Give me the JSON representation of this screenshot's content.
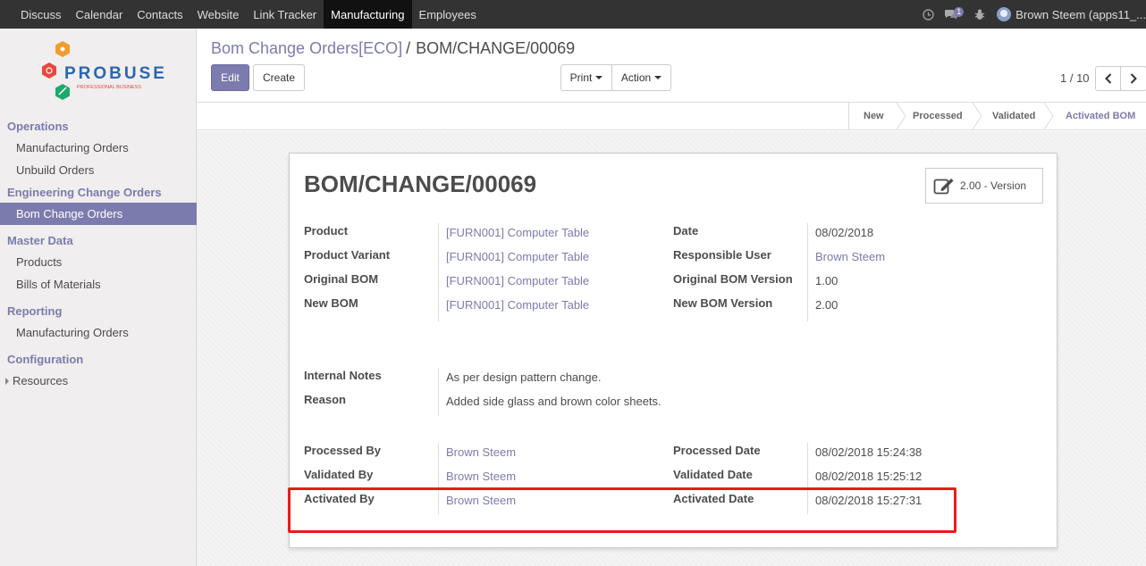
{
  "topbar": {
    "menu": [
      "Discuss",
      "Calendar",
      "Contacts",
      "Website",
      "Link Tracker",
      "Manufacturing",
      "Employees"
    ],
    "active_menu": "Manufacturing",
    "messages_badge": "1",
    "user": "Brown Steem (apps11_..."
  },
  "sidebar": {
    "logo_text": "PROBUSE",
    "logo_sub": "PROFESSIONAL BUSINESS",
    "sections": [
      {
        "title": "Operations",
        "items": [
          "Manufacturing Orders",
          "Unbuild Orders"
        ]
      },
      {
        "title": "Engineering Change Orders",
        "items": [
          "Bom Change Orders"
        ]
      },
      {
        "title": "Master Data",
        "items": [
          "Products",
          "Bills of Materials"
        ]
      },
      {
        "title": "Reporting",
        "items": [
          "Manufacturing Orders"
        ]
      },
      {
        "title": "Configuration",
        "items": [
          "Resources"
        ]
      }
    ],
    "active_item": "Bom Change Orders"
  },
  "breadcrumb": {
    "parent": "Bom Change Orders[ECO]",
    "separator": "/",
    "current": "BOM/CHANGE/00069"
  },
  "buttons": {
    "edit": "Edit",
    "create": "Create",
    "print": "Print",
    "action": "Action"
  },
  "pager": {
    "value": "1 / 10"
  },
  "status_stages": [
    "New",
    "Processed",
    "Validated",
    "Activated BOM"
  ],
  "current_stage": "Activated BOM",
  "record": {
    "name": "BOM/CHANGE/00069",
    "version_button": "2.00 - Version",
    "left_fields": [
      {
        "label": "Product",
        "value": "[FURN001] Computer Table"
      },
      {
        "label": "Product Variant",
        "value": "[FURN001] Computer Table"
      },
      {
        "label": "Original BOM",
        "value": "[FURN001] Computer Table"
      },
      {
        "label": "New BOM",
        "value": "[FURN001] Computer Table"
      }
    ],
    "right_fields": [
      {
        "label": "Date",
        "value": "08/02/2018"
      },
      {
        "label": "Responsible User",
        "value": "Brown Steem"
      },
      {
        "label": "Original BOM Version",
        "value": "1.00"
      },
      {
        "label": "New BOM Version",
        "value": "2.00"
      }
    ],
    "notes": [
      {
        "label": "Internal Notes",
        "value": "As per design pattern change."
      },
      {
        "label": "Reason",
        "value": "Added side glass and brown color sheets."
      }
    ],
    "audit_left": [
      {
        "label": "Processed By",
        "value": "Brown Steem"
      },
      {
        "label": "Validated By",
        "value": "Brown Steem"
      },
      {
        "label": "Activated By",
        "value": "Brown Steem"
      }
    ],
    "audit_right": [
      {
        "label": "Processed Date",
        "value": "08/02/2018 15:24:38"
      },
      {
        "label": "Validated Date",
        "value": "08/02/2018 15:25:12"
      },
      {
        "label": "Activated Date",
        "value": "08/02/2018 15:27:31"
      }
    ]
  },
  "colors": {
    "accent": "#7c7bad",
    "topbar": "#333333",
    "highlight": "#e81c1c"
  }
}
